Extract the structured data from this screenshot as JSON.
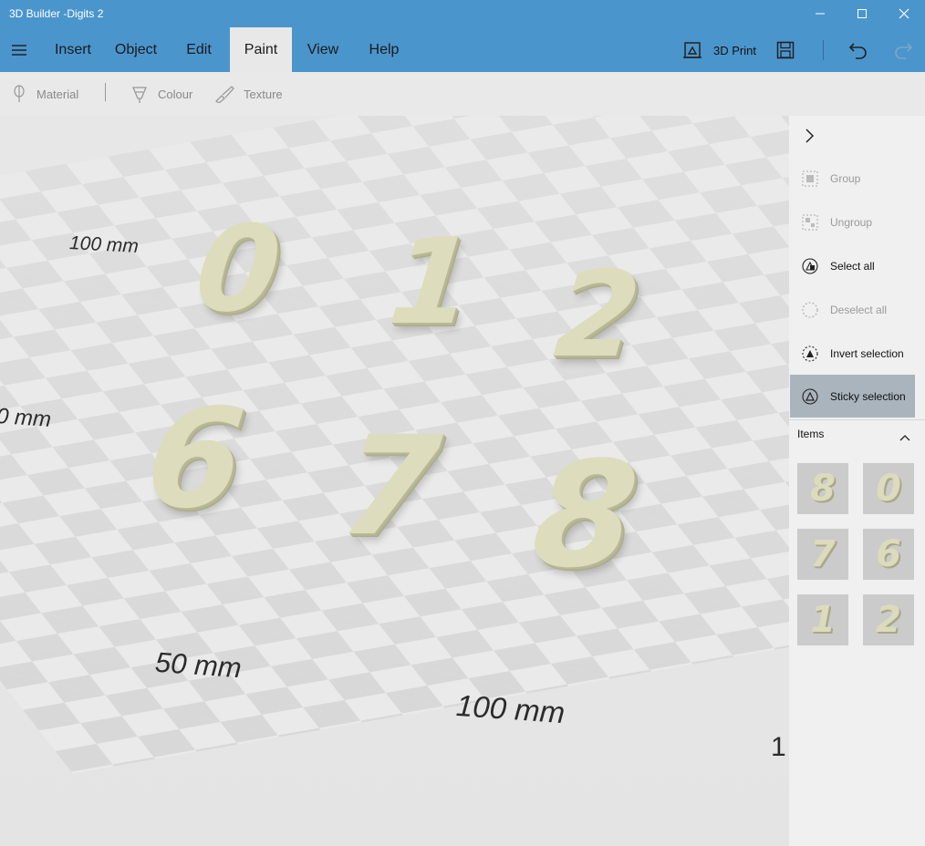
{
  "app": {
    "title": "3D Builder -Digits 2"
  },
  "menu": {
    "tabs": [
      "Insert",
      "Object",
      "Edit",
      "Paint",
      "View",
      "Help"
    ],
    "active": "Paint",
    "print_label": "3D Print"
  },
  "toolbar": {
    "material": "Material",
    "colour": "Colour",
    "texture": "Texture"
  },
  "canvas": {
    "labels": [
      "100 mm",
      "0 mm",
      "50 mm",
      "100 mm",
      "1"
    ],
    "digits": [
      "0",
      "1",
      "2",
      "6",
      "7",
      "8"
    ]
  },
  "panel": {
    "group": "Group",
    "ungroup": "Ungroup",
    "select_all": "Select all",
    "deselect_all": "Deselect all",
    "invert_selection": "Invert selection",
    "sticky_selection": "Sticky selection",
    "items_header": "Items",
    "items": [
      "8",
      "0",
      "7",
      "6",
      "1",
      "2"
    ]
  },
  "colors": {
    "accent": "#4b95cd",
    "model": "#dddcbd",
    "selected": "#a9b4bd"
  }
}
